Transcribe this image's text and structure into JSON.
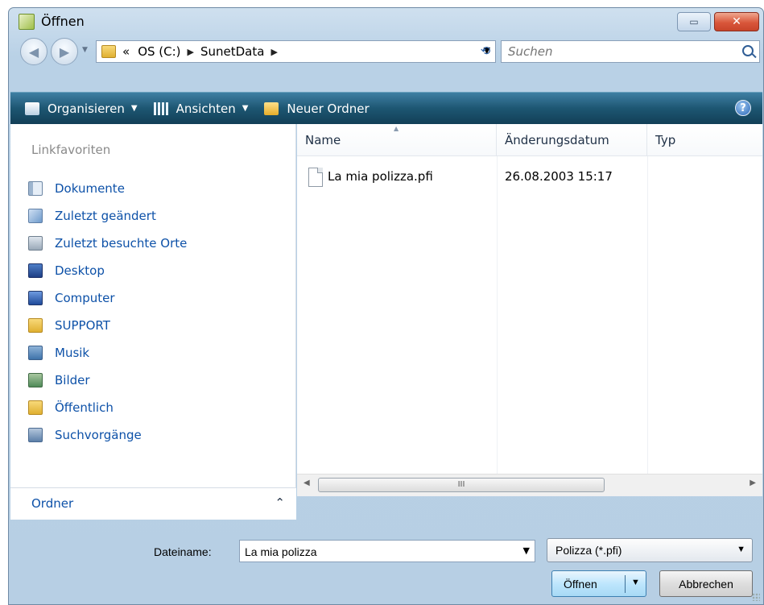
{
  "window": {
    "title": "Öffnen"
  },
  "address": {
    "prefix": "«",
    "crumbs": [
      "OS (C:)",
      "SunetData"
    ]
  },
  "search": {
    "placeholder": "Suchen"
  },
  "toolbar": {
    "organize": "Organisieren",
    "views": "Ansichten",
    "new_folder": "Neuer Ordner",
    "help": "?"
  },
  "navpane": {
    "title": "Linkfavoriten",
    "items": [
      {
        "label": "Dokumente",
        "icon": "documents-icon"
      },
      {
        "label": "Zuletzt geändert",
        "icon": "recent-changed-icon"
      },
      {
        "label": "Zuletzt besuchte Orte",
        "icon": "recent-places-icon"
      },
      {
        "label": "Desktop",
        "icon": "desktop-icon"
      },
      {
        "label": "Computer",
        "icon": "computer-icon"
      },
      {
        "label": "SUPPORT",
        "icon": "folder-icon"
      },
      {
        "label": "Musik",
        "icon": "music-icon"
      },
      {
        "label": "Bilder",
        "icon": "pictures-icon"
      },
      {
        "label": "Öffentlich",
        "icon": "folder-icon"
      },
      {
        "label": "Suchvorgänge",
        "icon": "searches-icon"
      }
    ],
    "folders_label": "Ordner"
  },
  "filelist": {
    "columns": [
      "Name",
      "Änderungsdatum",
      "Typ"
    ],
    "rows": [
      {
        "name": "La mia polizza.pfi",
        "date": "26.08.2003 15:17",
        "type": ""
      }
    ],
    "hscroll_grip": "III"
  },
  "footer": {
    "filename_label": "Dateiname:",
    "filename_value": "La mia polizza",
    "filetype": "Polizza (*.pfi)",
    "open_label": "Öffnen",
    "cancel_label": "Abbrechen"
  }
}
